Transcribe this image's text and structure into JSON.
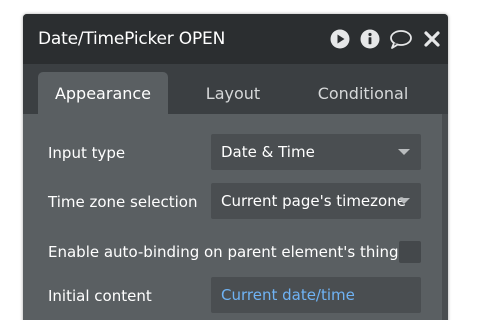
{
  "window": {
    "title": "Date/TimePicker OPEN"
  },
  "title_icons": [
    "play-icon",
    "info-icon",
    "comment-icon",
    "close-icon"
  ],
  "tabs": [
    {
      "label": "Appearance",
      "active": true
    },
    {
      "label": "Layout",
      "active": false
    },
    {
      "label": "Conditional",
      "active": false
    }
  ],
  "fields": {
    "input_type": {
      "label": "Input type",
      "value": "Date & Time"
    },
    "time_zone": {
      "label": "Time zone selection",
      "value": "Current page's timezone"
    },
    "auto_binding": {
      "label": "Enable auto-binding on parent element's thing",
      "checked": false
    },
    "initial_content": {
      "label": "Initial content",
      "value": "Current date/time"
    }
  },
  "colors": {
    "panel": "#5a5f62",
    "titlebar": "#2b2e30",
    "tabbar": "#3b3f42",
    "dynamic_text": "#6fb3f5"
  }
}
